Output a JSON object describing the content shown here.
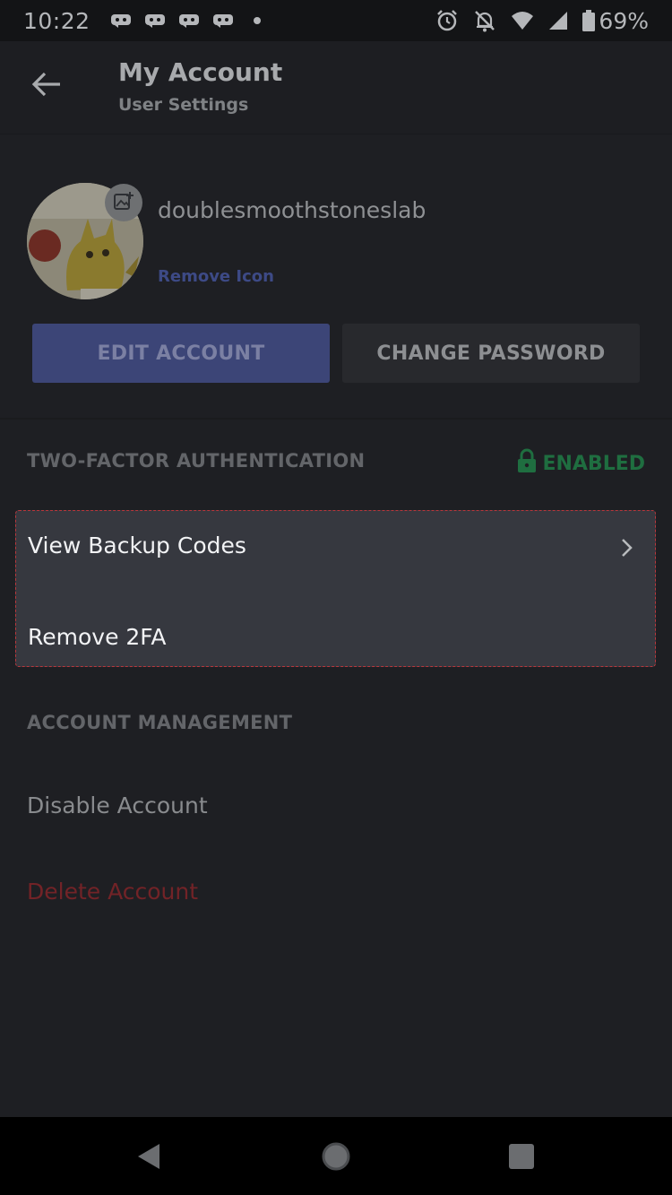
{
  "status_bar": {
    "time": "10:22",
    "battery": "69%",
    "icons": [
      "discord-notification-icon",
      "discord-notification-icon",
      "discord-notification-icon",
      "discord-notification-icon",
      "dot-icon",
      "alarm-icon",
      "dnd-bell-off-icon",
      "wifi-icon",
      "signal-icon",
      "battery-icon"
    ]
  },
  "header": {
    "title": "My Account",
    "subtitle": "User Settings",
    "back_icon": "arrow-left-icon"
  },
  "profile": {
    "username": "doublesmoothstoneslab",
    "remove_icon_label": "Remove Icon",
    "edit_button": "EDIT ACCOUNT",
    "change_password_button": "CHANGE PASSWORD"
  },
  "two_factor": {
    "section_label": "TWO-FACTOR AUTHENTICATION",
    "status": "ENABLED",
    "status_color": "#1f6e40",
    "items": [
      {
        "label": "View Backup Codes"
      },
      {
        "label": "Remove 2FA"
      }
    ],
    "highlight_color": "#b9373c"
  },
  "account_management": {
    "section_label": "ACCOUNT MANAGEMENT",
    "disable_label": "Disable Account",
    "delete_label": "Delete Account",
    "delete_color": "#722327"
  },
  "nav": {
    "icons": [
      "nav-back-icon",
      "nav-home-icon",
      "nav-recents-icon"
    ]
  }
}
